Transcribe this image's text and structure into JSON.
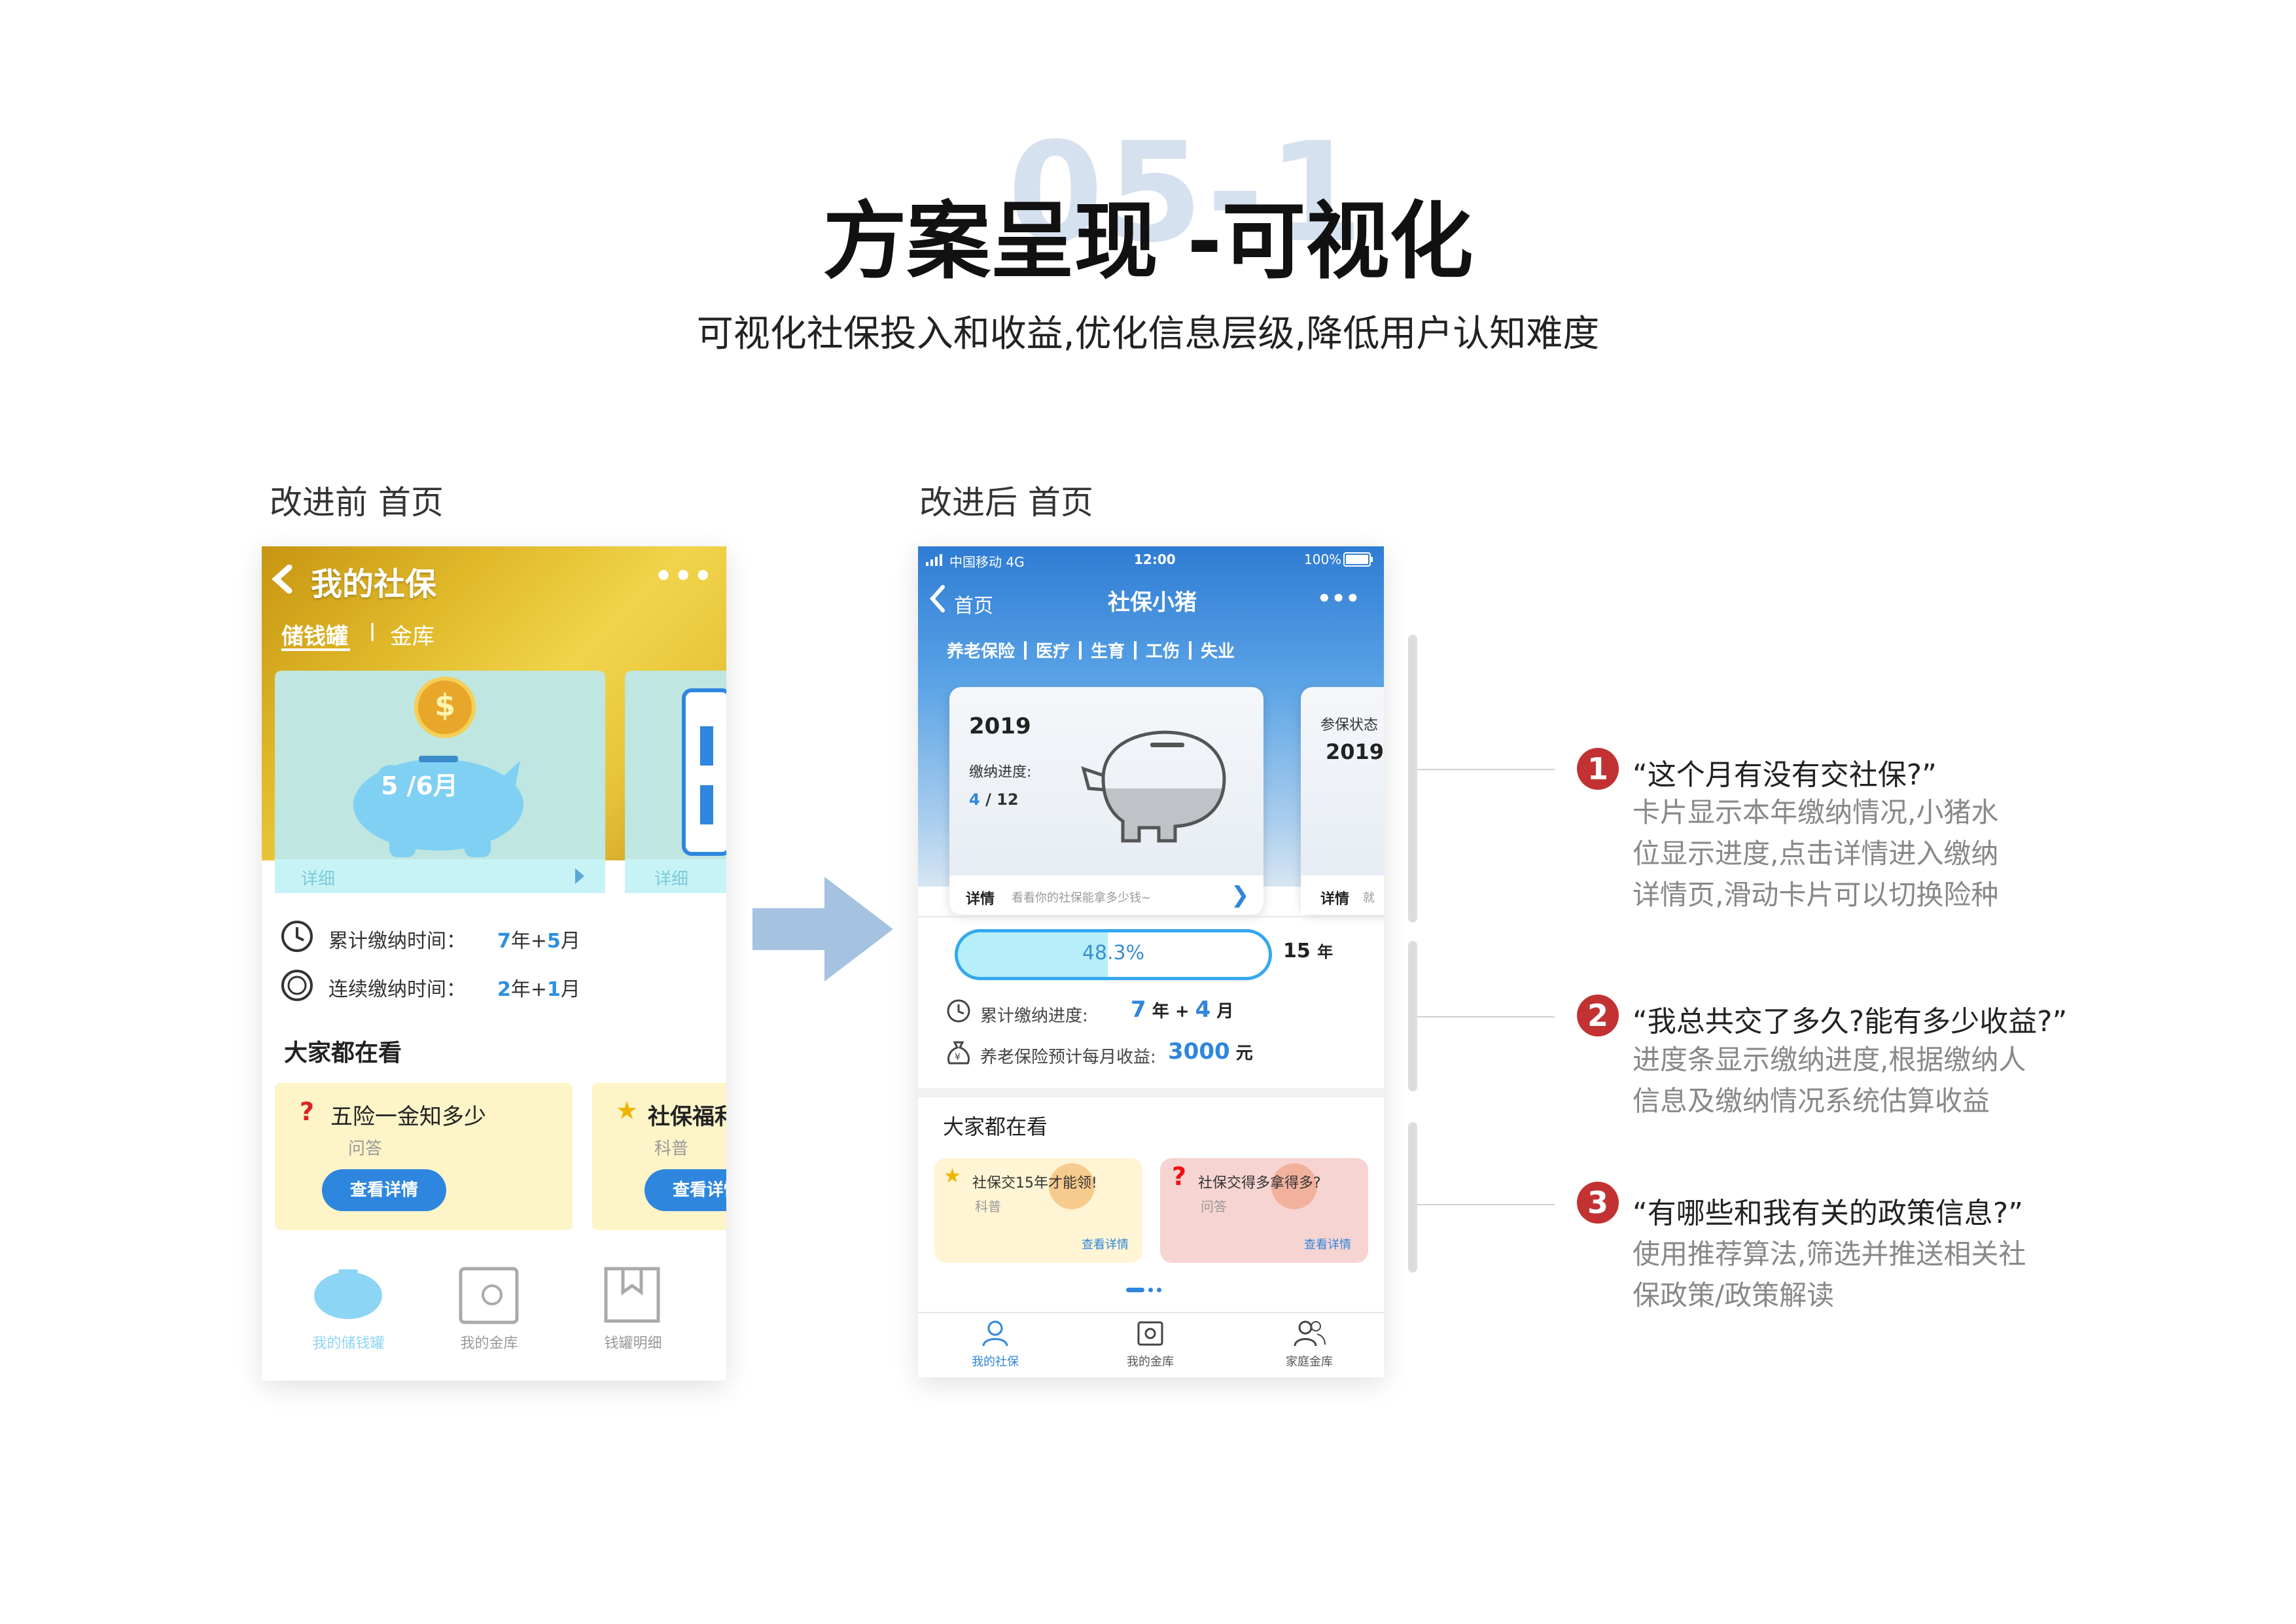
{
  "header": {
    "bg_number": "05-1",
    "title": "方案呈现 -可视化",
    "subtitle": "可视化社保投入和收益,优化信息层级,降低用户认知难度"
  },
  "labels": {
    "before": "改进前 首页",
    "after": "改进后 首页"
  },
  "old_phone": {
    "title": "我的社保",
    "more": "•••",
    "tabs": [
      "储钱罐",
      "金库"
    ],
    "tab_divider": "|",
    "coin_symbol": "$",
    "piggy_progress": "5 /6月",
    "detail_label": "详细",
    "detail_label_2": "详细",
    "rows": [
      {
        "label": "累计缴纳时间：",
        "year": "7",
        "year_unit": "年+",
        "month": "5",
        "month_unit": "月"
      },
      {
        "label": "连续缴纳时间：",
        "year": "2",
        "year_unit": "年+",
        "month": "1",
        "month_unit": "月"
      }
    ],
    "section_title": "大家都在看",
    "cards": [
      {
        "icon": "?",
        "title": "五险一金知多少",
        "tag": "问答",
        "button": "查看详情"
      },
      {
        "icon": "★",
        "title": "社保福利",
        "tag": "科普",
        "button": "查看详情"
      }
    ],
    "tabbar": [
      "我的储钱罐",
      "我的金库",
      "钱罐明细"
    ]
  },
  "new_phone": {
    "status": {
      "carrier": "中国移动 4G",
      "time": "12:00",
      "battery": "100%"
    },
    "back_label": "首页",
    "title": "社保小猪",
    "more": "•••",
    "categories": [
      "养老保险",
      "医疗",
      "生育",
      "工伤",
      "失业"
    ],
    "main_card": {
      "year": "2019",
      "progress_label": "缴纳进度:",
      "done": "4",
      "total": "/ 12",
      "detail_label": "详情",
      "detail_hint": "看看你的社保能拿多少钱~",
      "chevron": "❯"
    },
    "side_card": {
      "label": "参保状态",
      "year": "2019",
      "detail_label": "详情",
      "detail_hint": "就"
    },
    "progress": {
      "percent_text": "48.3%",
      "fraction": 0.483,
      "years": "15",
      "years_unit": "年"
    },
    "cumulative": {
      "label": "累计缴纳进度:",
      "years": "7",
      "years_unit": "年",
      "plus": "+",
      "months": "4",
      "months_unit": "月"
    },
    "income": {
      "label": "养老保险预计每月收益:",
      "value": "3000",
      "unit": "元"
    },
    "section_title": "大家都在看",
    "cards": [
      {
        "icon": "★",
        "title": "社保交15年才能领!",
        "tag": "科普",
        "link": "查看详情",
        "color": "#fff4d4"
      },
      {
        "icon": "?",
        "title": "社保交得多拿得多?",
        "tag": "问答",
        "link": "查看详情",
        "color": "#f6d4d2"
      }
    ],
    "tabbar": [
      "我的社保",
      "我的金库",
      "家庭金库"
    ]
  },
  "annotations": [
    {
      "num": "1",
      "question": "“这个月有没有交社保?”",
      "desc": [
        "卡片显示本年缴纳情况,小猪水",
        "位显示进度,点击详情进入缴纳",
        "详情页,滑动卡片可以切换险种"
      ]
    },
    {
      "num": "2",
      "question": "“我总共交了多久?能有多少收益?”",
      "desc": [
        "进度条显示缴纳进度,根据缴纳人",
        "信息及缴纳情况系统估算收益"
      ]
    },
    {
      "num": "3",
      "question": "“有哪些和我有关的政策信息?”",
      "desc": [
        "使用推荐算法,筛选并推送相关社",
        "保政策/政策解读"
      ]
    }
  ],
  "colors": {
    "accent_blue": "#2f86dc",
    "badge_red": "#c23232",
    "arrow": "#a5c3e0"
  }
}
